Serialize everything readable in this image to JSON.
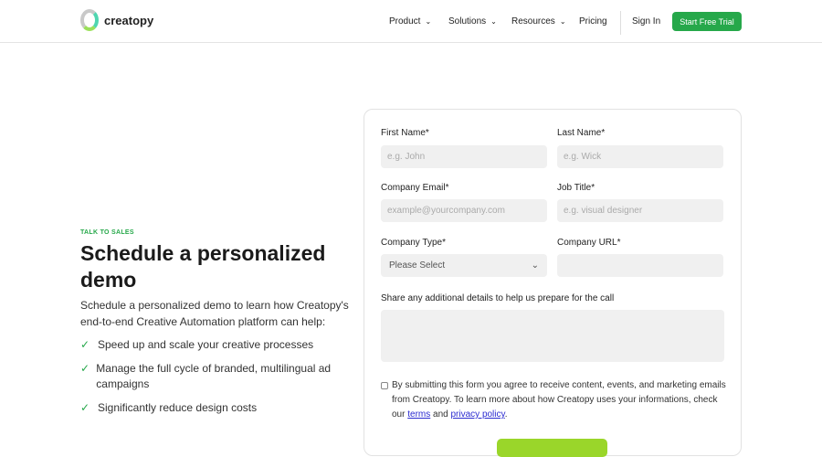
{
  "header": {
    "brand": "creatopy",
    "nav": [
      "Product",
      "Solutions",
      "Resources",
      "Pricing"
    ],
    "sign_in": "Sign In",
    "cta": "Start Free Trial"
  },
  "hero": {
    "eyebrow": "TALK TO SALES",
    "title": "Schedule a personalized demo",
    "description": "Schedule a personalized demo to learn how Creatopy's end-to-end Creative Automation platform can help:",
    "bullets": [
      "Speed up and scale your creative processes",
      "Manage the full cycle of branded, multilingual ad campaigns",
      "Significantly reduce design costs"
    ]
  },
  "form": {
    "first_name": {
      "label": "First Name*",
      "placeholder": "e.g. John"
    },
    "last_name": {
      "label": "Last Name*",
      "placeholder": "e.g. Wick"
    },
    "email": {
      "label": "Company Email*",
      "placeholder": "example@yourcompany.com"
    },
    "job": {
      "label": "Job Title*",
      "placeholder": "e.g. visual designer"
    },
    "company_type": {
      "label": "Company Type*",
      "value": "Please Select"
    },
    "company_url": {
      "label": "Company URL*",
      "placeholder": ""
    },
    "details": {
      "label": "Share any additional details to help us prepare for the call"
    },
    "consent": {
      "text": "By submitting this form you agree to receive content, events, and marketing emails from Creatopy. To learn more about how Creatopy uses your informations, check our",
      "terms": "terms",
      "and": "and",
      "privacy": "privacy policy",
      "end": "."
    }
  }
}
